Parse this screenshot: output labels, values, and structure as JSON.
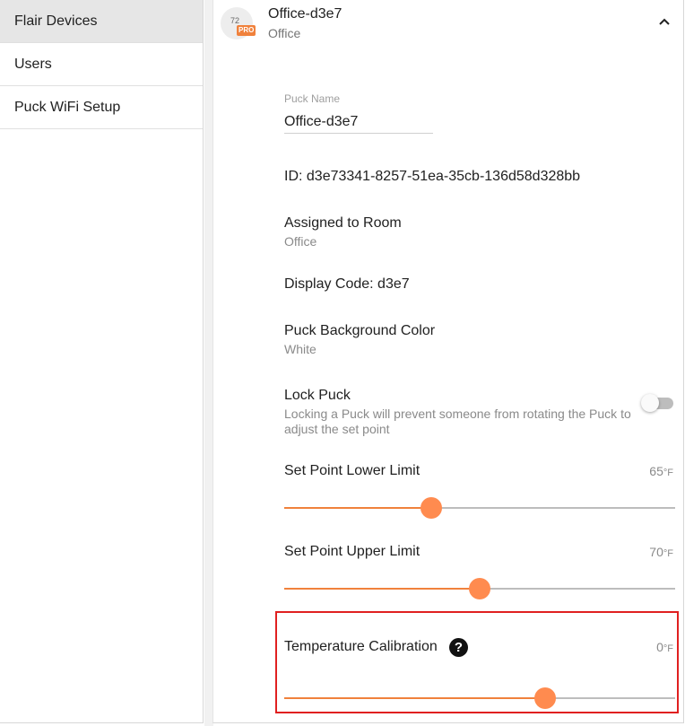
{
  "sidebar": {
    "items": [
      {
        "label": "Flair Devices",
        "active": true
      },
      {
        "label": "Users",
        "active": false
      },
      {
        "label": "Puck WiFi Setup",
        "active": false
      }
    ]
  },
  "device": {
    "title": "Office-d3e7",
    "subtitle": "Office",
    "avatar_number": "72",
    "avatar_badge": "PRO",
    "collapse_icon": "chevron-up-icon"
  },
  "puck_name": {
    "label": "Puck Name",
    "value": "Office-d3e7"
  },
  "id_text": "ID: d3e73341-8257-51ea-35cb-136d58d328bb",
  "assigned_room": {
    "label": "Assigned to Room",
    "value": "Office"
  },
  "display_code": "Display Code: d3e7",
  "background_color": {
    "label": "Puck Background Color",
    "value": "White"
  },
  "lock_puck": {
    "label": "Lock Puck",
    "description": "Locking a Puck will prevent someone from rotating the Puck to adjust the set point",
    "enabled": false
  },
  "set_point_lower": {
    "label": "Set Point Lower Limit",
    "value": "65",
    "unit": "°F",
    "slider_fraction": 0.376
  },
  "set_point_upper": {
    "label": "Set Point Upper Limit",
    "value": "70",
    "unit": "°F",
    "slider_fraction": 0.5
  },
  "temperature_calibration": {
    "label": "Temperature Calibration",
    "help_symbol": "?",
    "value": "0",
    "unit": "°F",
    "slider_fraction": 0.667,
    "highlighted": true
  },
  "colors": {
    "accent": "#ff8b4f",
    "highlight_border": "#e02020",
    "pro_badge": "#f0813c"
  }
}
